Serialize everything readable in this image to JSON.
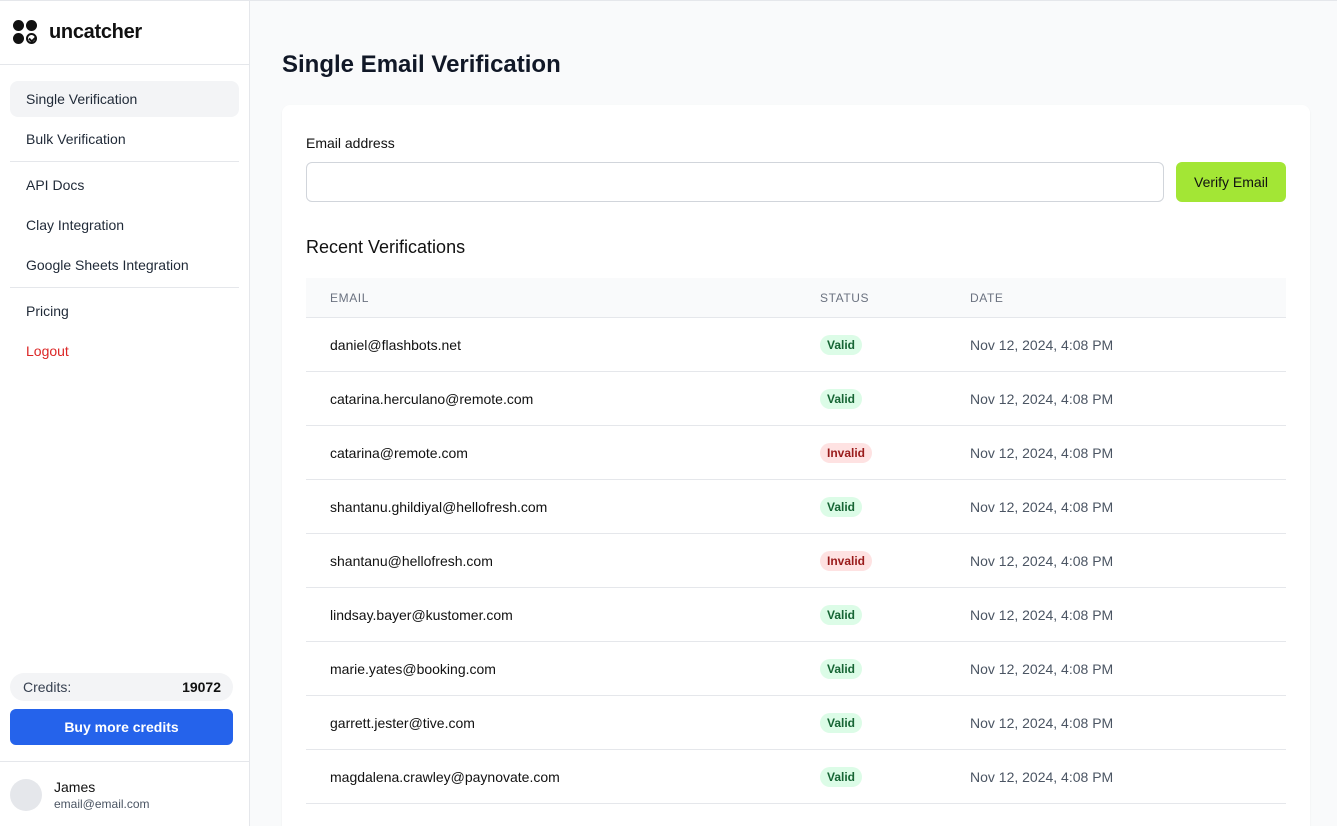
{
  "brand": {
    "name": "uncatcher"
  },
  "nav": {
    "single": "Single Verification",
    "bulk": "Bulk Verification",
    "api": "API Docs",
    "clay": "Clay Integration",
    "sheets": "Google Sheets Integration",
    "pricing": "Pricing",
    "logout": "Logout"
  },
  "credits": {
    "label": "Credits:",
    "value": "19072",
    "buy_label": "Buy more credits"
  },
  "user": {
    "name": "James",
    "email": "email@email.com"
  },
  "page": {
    "title": "Single Email Verification"
  },
  "form": {
    "label": "Email address",
    "value": "",
    "placeholder": "",
    "button": "Verify Email"
  },
  "recent": {
    "title": "Recent Verifications",
    "columns": [
      "Email",
      "Status",
      "Date"
    ],
    "rows": [
      {
        "email": "daniel@flashbots.net",
        "status": "Valid",
        "date": "Nov 12, 2024, 4:08 PM"
      },
      {
        "email": "catarina.herculano@remote.com",
        "status": "Valid",
        "date": "Nov 12, 2024, 4:08 PM"
      },
      {
        "email": "catarina@remote.com",
        "status": "Invalid",
        "date": "Nov 12, 2024, 4:08 PM"
      },
      {
        "email": "shantanu.ghildiyal@hellofresh.com",
        "status": "Valid",
        "date": "Nov 12, 2024, 4:08 PM"
      },
      {
        "email": "shantanu@hellofresh.com",
        "status": "Invalid",
        "date": "Nov 12, 2024, 4:08 PM"
      },
      {
        "email": "lindsay.bayer@kustomer.com",
        "status": "Valid",
        "date": "Nov 12, 2024, 4:08 PM"
      },
      {
        "email": "marie.yates@booking.com",
        "status": "Valid",
        "date": "Nov 12, 2024, 4:08 PM"
      },
      {
        "email": "garrett.jester@tive.com",
        "status": "Valid",
        "date": "Nov 12, 2024, 4:08 PM"
      },
      {
        "email": "magdalena.crawley@paynovate.com",
        "status": "Valid",
        "date": "Nov 12, 2024, 4:08 PM"
      }
    ]
  },
  "colors": {
    "accent_blue": "#2563eb",
    "verify_green": "#a3e635",
    "logout_red": "#dc2626",
    "valid_bg": "#dcfce7",
    "invalid_bg": "#fee2e2"
  }
}
